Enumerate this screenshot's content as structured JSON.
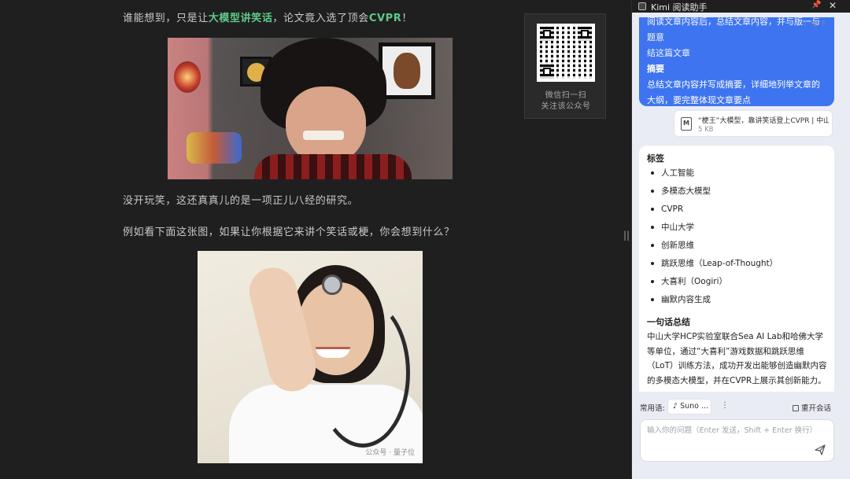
{
  "article": {
    "p1_a": "谁能想到，只是让",
    "p1_hl1": "大模型讲笑话",
    "p1_b": "，论文竟入选了顶会",
    "p1_hl2": "CVPR",
    "p1_c": "！",
    "p2": "没开玩笑，这还真真儿的是一项正儿八经的研究。",
    "p3": "例如看下面这张图，如果让你根据它来讲个笑话或梗，你会想到什么？",
    "watermark": "公众号 · 量子位",
    "qr_caption_1": "微信扫一扫",
    "qr_caption_2": "关注该公众号",
    "highlight_color": "#5fc98a"
  },
  "panel": {
    "title": "Kimi 阅读助手",
    "pin_icon": "pin-icon",
    "close_icon": "close-icon",
    "user_bubble": {
      "line_top": "阅读文章内容后，总结文章内容，并与版一与题意",
      "line_top2": "结这篇文章",
      "heading": "摘要",
      "body": "总结文章内容并写成摘要，详细地列举文章的大纲，要完整体现文章要点",
      "bg": "#3e74f0"
    },
    "file": {
      "name": "“梗王”大模型，靠讲笑话登上CVPR | 中山大学",
      "size": "5 KB",
      "icon": "M"
    },
    "tags_heading": "标签",
    "tags": [
      "人工智能",
      "多模态大模型",
      "CVPR",
      "中山大学",
      "创新思维",
      "跳跃思维（Leap-of-Thought）",
      "大喜利（Oogiri）",
      "幽默内容生成"
    ],
    "summary_heading": "一句话总结",
    "summary": "中山大学HCP实验室联合Sea AI Lab和哈佛大学等单位，通过“大喜利”游戏数据和跳跃思维（LoT）训练方法，成功开发出能够创造幽默内容的多模态大模型，并在CVPR上展示其创新能力。",
    "common_label": "常用语:",
    "suno_label": "Suno ...",
    "more_label": "⋮",
    "reset_label": "重开会话",
    "input_placeholder": "输入你的问题（Enter 发送，Shift + Enter 换行）",
    "drag_handle": "||"
  }
}
